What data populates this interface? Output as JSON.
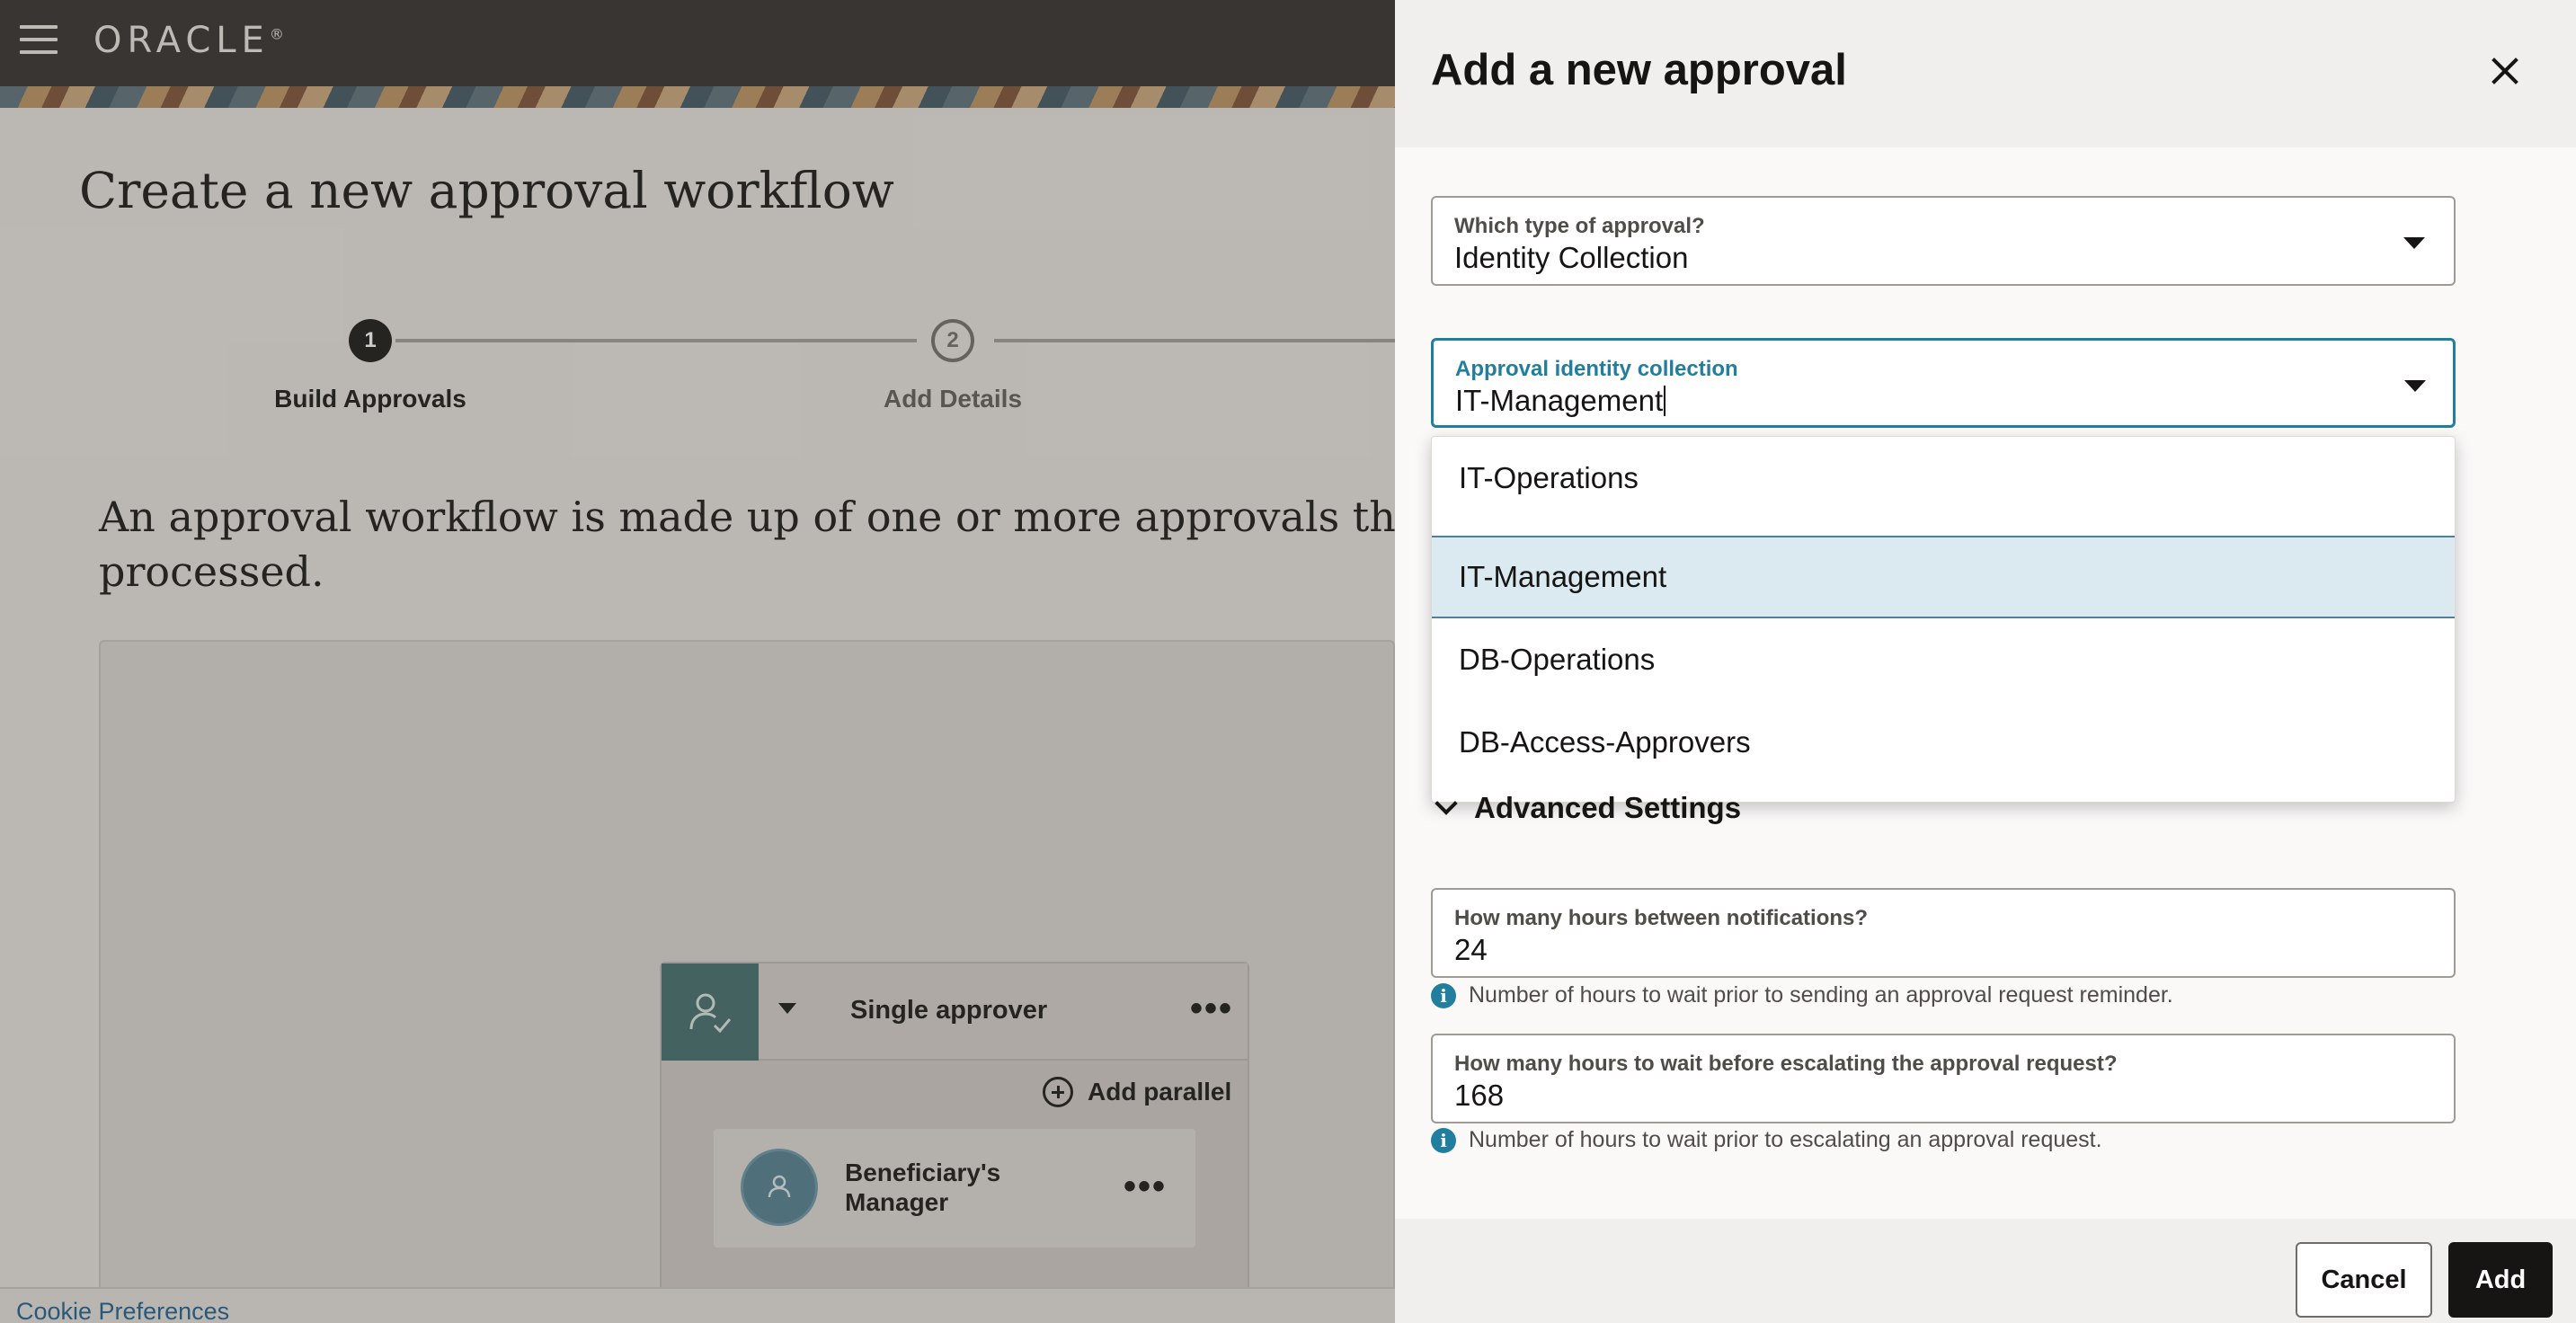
{
  "header": {
    "brand": "ORACLE",
    "logo_mark": "®"
  },
  "page": {
    "title": "Create a new approval workflow",
    "intro_line1": "An approval workflow is made up of one or more approvals that define",
    "intro_line2": "processed."
  },
  "stepper": {
    "steps": [
      {
        "number": "1",
        "label": "Build Approvals",
        "state": "active"
      },
      {
        "number": "2",
        "label": "Add Details",
        "state": "inactive"
      }
    ]
  },
  "workflow": {
    "approval_name": "Single approver",
    "add_parallel_label": "Add parallel",
    "approver_name_line1": "Beneficiary's",
    "approver_name_line2": "Manager",
    "more_glyph": "•••"
  },
  "footer": {
    "cookie_link": "Cookie Preferences"
  },
  "drawer": {
    "title": "Add a new approval",
    "approval_type": {
      "label": "Which type of approval?",
      "value": "Identity Collection"
    },
    "identity_collection": {
      "label": "Approval identity collection",
      "value": "IT-Management",
      "options": [
        "IT-Operations",
        "IT-Management",
        "DB-Operations",
        "DB-Access-Approvers"
      ],
      "selected_index": 1
    },
    "advanced_settings_label": "Advanced Settings",
    "notifications": {
      "label": "How many hours between notifications?",
      "value": "24",
      "help": "Number of hours to wait prior to sending an approval request reminder."
    },
    "escalation": {
      "label": "How many hours to wait before escalating the approval request?",
      "value": "168",
      "help": "Number of hours to wait prior to escalating an approval request."
    },
    "cancel_label": "Cancel",
    "add_label": "Add"
  },
  "colors": {
    "header_bg": "#312d2a",
    "focus_accent": "#227e9e",
    "selected_option_bg": "#dbeaf1",
    "primary_button": "#161513"
  },
  "icons": [
    "menu-icon",
    "close-icon",
    "chevron-down-icon",
    "info-icon",
    "user-check-icon",
    "user-icon",
    "add-circle-icon",
    "more-icon"
  ]
}
